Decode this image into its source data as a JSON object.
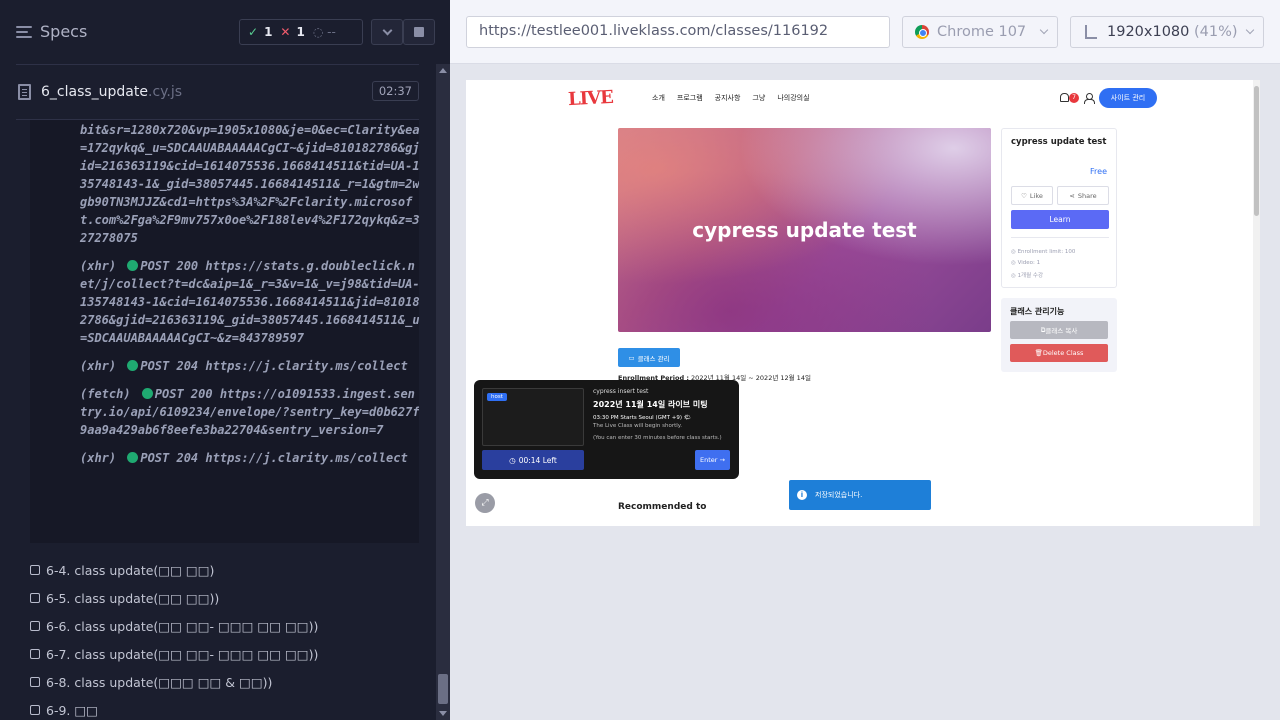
{
  "runner": {
    "header": {
      "title": "Specs"
    },
    "stats": {
      "passed": "1",
      "failed": "1",
      "pending": "--"
    },
    "spec_file": {
      "name": "6_class_update",
      "ext": ".cy.js",
      "duration": "02:37"
    },
    "log_entries": [
      {
        "text": "bit&sr=1280x720&vp=1905x1080&je=0&ec=Clarity&ea=172qykq&_u=SDCAAUABAAAAACgCI~&jid=810182786&gjid=216363119&cid=1614075536.1668414511&tid=UA-135748143-1&_gid=38057445.1668414511&_r=1&gtm=2wgb90TN3MJJZ&cd1=https%3A%2F%2Fclarity.microsoft.com%2Fga%2F9mv757x0oe%2F188lev4%2F172qykq&z=327278075"
      },
      {
        "prefix": "(xhr) ",
        "status": "POST 200",
        "text": "https://stats.g.doubleclick.net/j/collect?t=dc&aip=1&_r=3&v=1&_v=j98&tid=UA-135748143-1&cid=1614075536.1668414511&jid=810182786&gjid=216363119&_gid=38057445.1668414511&_u=SDCAAUABAAAAACgCI~&z=843789597"
      },
      {
        "prefix": "(xhr) ",
        "status": "POST 204",
        "text": "https://j.clarity.ms/collect"
      },
      {
        "prefix": "(fetch) ",
        "status": "POST 200",
        "text": "https://o1091533.ingest.sentry.io/api/6109234/envelope/?sentry_key=d0b627f9aa9a429ab6f8eefe3ba22704&sentry_version=7"
      },
      {
        "prefix": "(xhr) ",
        "status": "POST 204",
        "text": "https://j.clarity.ms/collect"
      }
    ],
    "tests": [
      "6-4. class update(□□ □□)",
      "6-5. class update(□□ □□))",
      "6-6. class update(□□ □□- □□□ □□ □□))",
      "6-7. class update(□□ □□- □□□ □□ □□))",
      "6-8. class update(□□□ □□ & □□))",
      "6-9. □□"
    ]
  },
  "browser": {
    "url": "https://testlee001.liveklass.com/classes/116192",
    "browser_name": "Chrome 107",
    "viewport": "1920x1080",
    "zoom": "(41%)"
  },
  "app": {
    "logo": "LIVE",
    "nav": [
      "소개",
      "프로그램",
      "공지사항",
      "그냥",
      "나의강의실"
    ],
    "notification_count": "7",
    "site_admin_label": "사이트 관리",
    "banner_title": "cypress update test",
    "card": {
      "title": "cypress update test",
      "price": "Free",
      "like_label": "Like",
      "share_label": "Share",
      "learn_label": "Learn",
      "info": [
        "Enrollment limit: 100",
        "Video: 1",
        "1개월 수강"
      ]
    },
    "management": {
      "title": "클래스 관리기능",
      "copy_label": "클래스 복사",
      "delete_label": "Delete Class"
    },
    "class_mgmt_button": "클래스 관리",
    "enrollment_label": "Enrollment Period :",
    "enrollment_value": "2022년 11월 14일 ~ 2022년 12월 14일",
    "live_popup": {
      "host_badge": "host",
      "subtitle": "cypress insert test",
      "title": "2022년 11월 14일 라이브 미팅",
      "time": "03:30 PM Starts Seoul (GMT +9) 🌤",
      "message1": "The Live Class will begin shortly.",
      "message2": "(You can enter 30 minutes before class starts.)",
      "left_label": "00:14 Left",
      "enter_label": "Enter →"
    },
    "toast": "저장되었습니다.",
    "recommended": "Recommended to"
  }
}
